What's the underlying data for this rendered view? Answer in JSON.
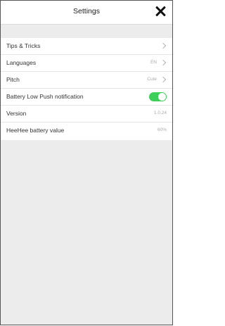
{
  "header": {
    "title": "Settings"
  },
  "settings": {
    "tips": {
      "label": "Tips & Tricks"
    },
    "languages": {
      "label": "Languages",
      "value": "EN"
    },
    "pitch": {
      "label": "Pitch",
      "value": "Cute"
    },
    "battery_push": {
      "label": "Battery Low Push notification",
      "enabled": true,
      "toggle_color": "#3ecf5a"
    },
    "version": {
      "label": "Version",
      "value": "1.0.24"
    },
    "battery_value": {
      "label": "HeeHee battery value",
      "value": "60%"
    }
  },
  "icons": {
    "close": "close-icon",
    "chevron": "chevron-right-icon"
  }
}
